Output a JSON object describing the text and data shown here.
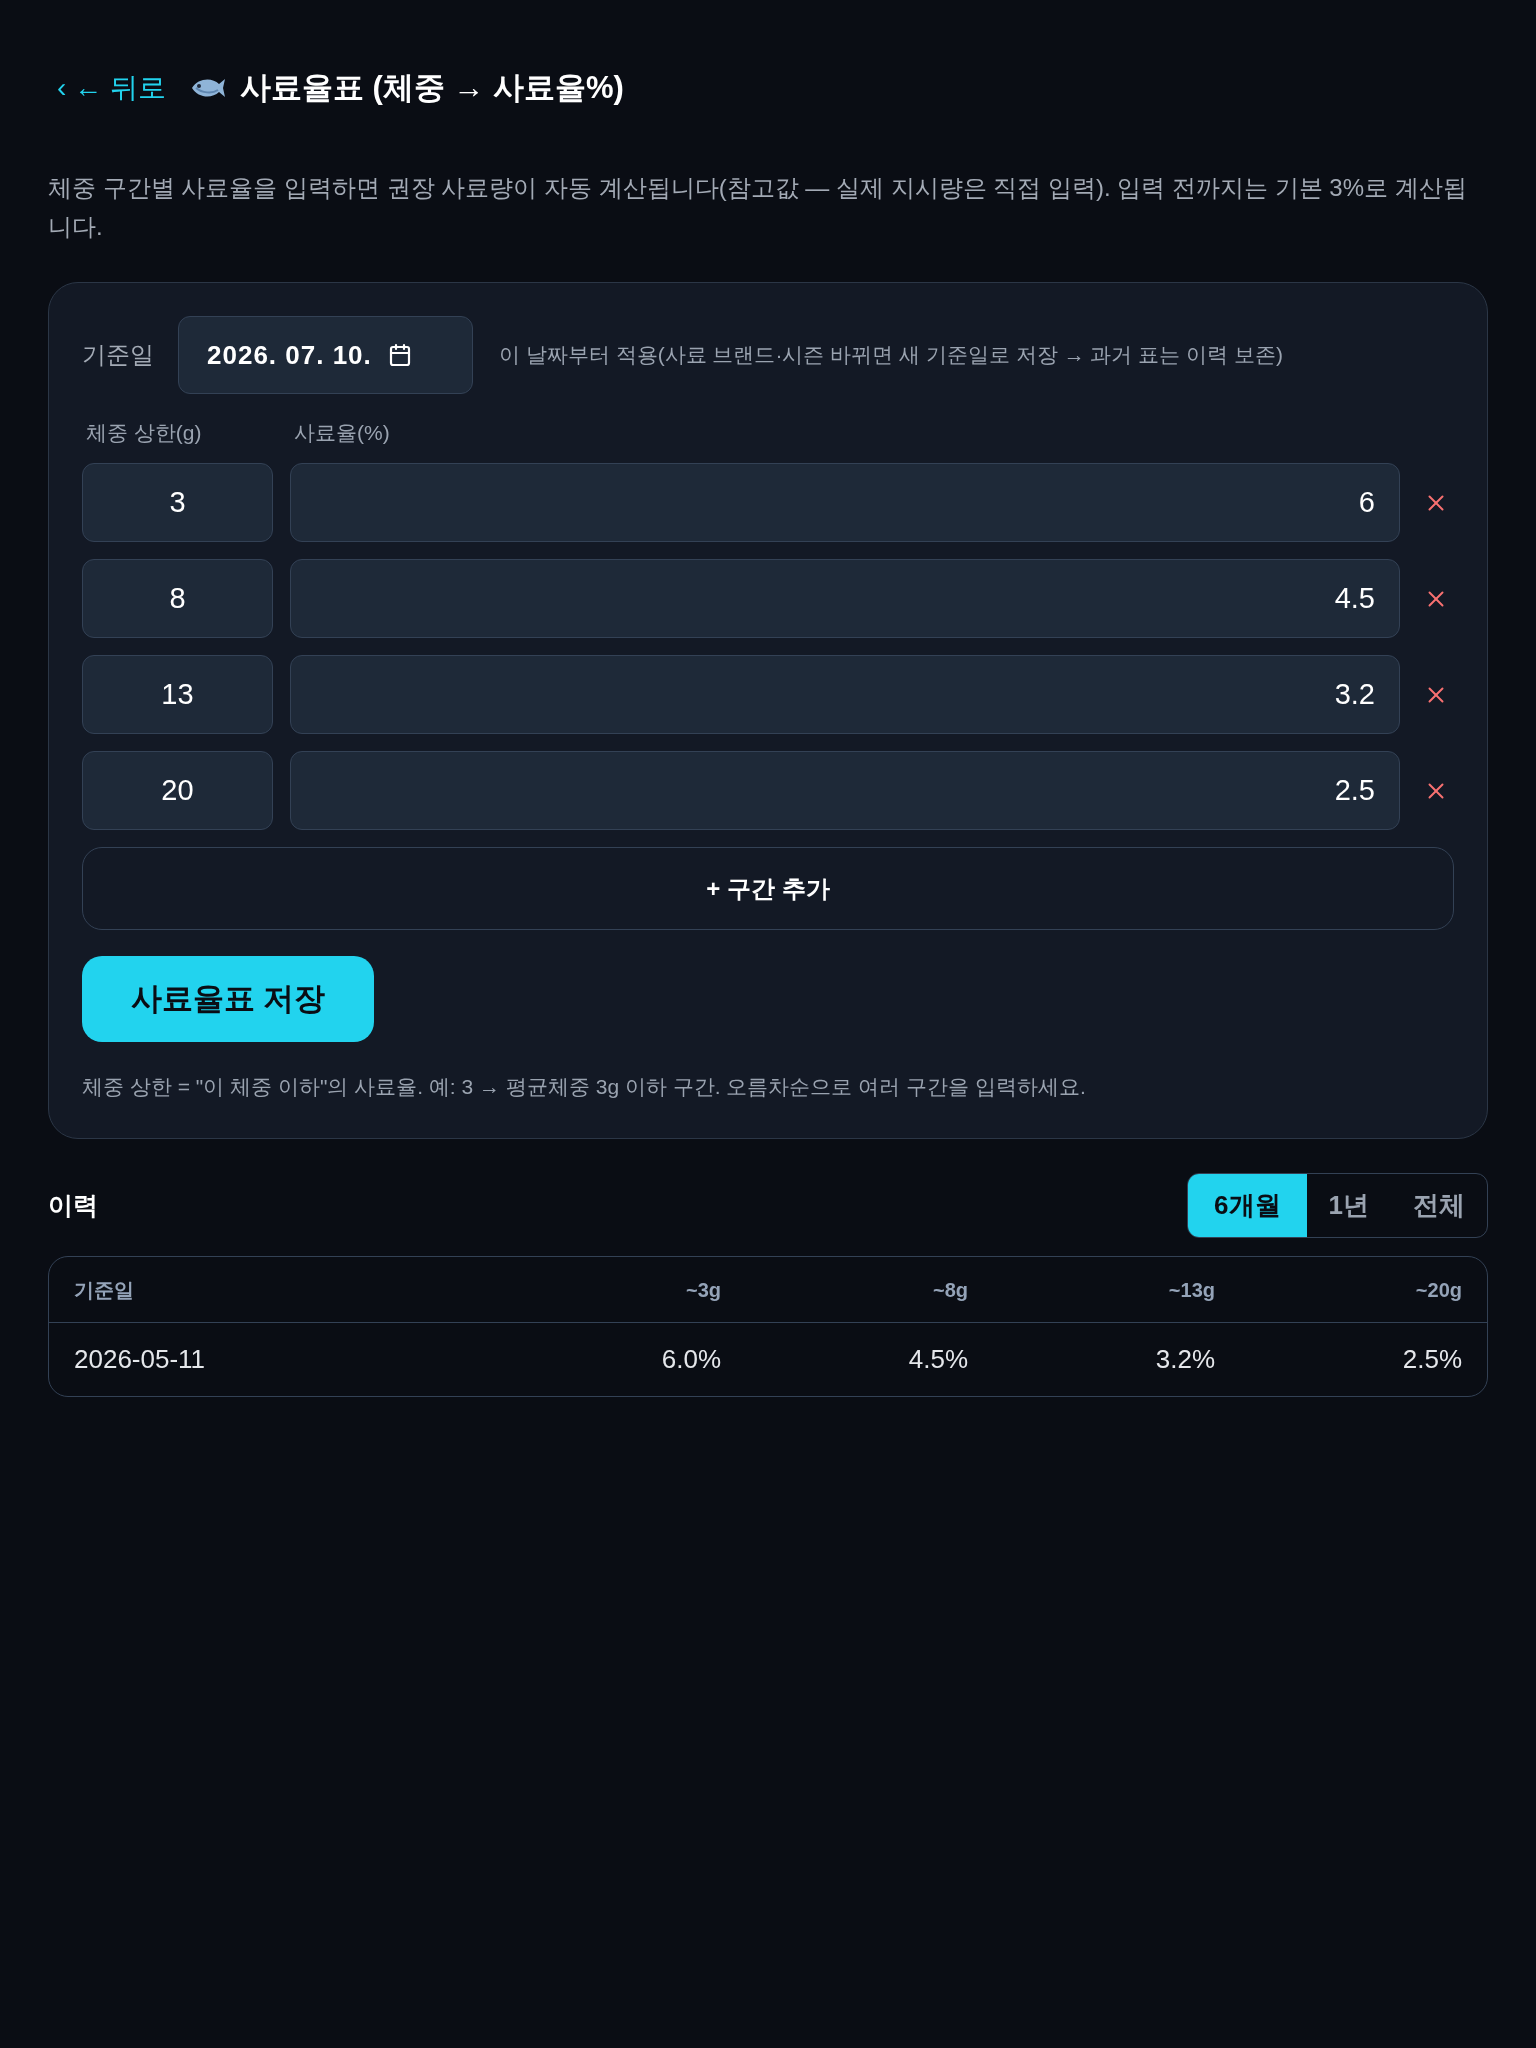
{
  "header": {
    "back_link": "‹ ← 뒤로",
    "title": "사료율표 (체중 → 사료율%)"
  },
  "description": "체중 구간별 사료율을 입력하면 권장 사료량이 자동 계산됩니다(참고값 — 실제 지시량은 직접 입력). 입력 전까지는 기본 3%로 계산됩니다.",
  "rate_form": {
    "date_label": "기준일",
    "date_value": "2026. 07. 10.",
    "date_hint": "이 날짜부터 적용(사료 브랜드·시즌 바뀌면 새 기준일로 저장 → 과거 표는 이력 보존)",
    "columns": [
      "체중 상한(g)",
      "사료율(%)"
    ],
    "rows": [
      {
        "weight_limit": "3",
        "rate": "6"
      },
      {
        "weight_limit": "8",
        "rate": "4.5"
      },
      {
        "weight_limit": "13",
        "rate": "3.2"
      },
      {
        "weight_limit": "20",
        "rate": "2.5"
      }
    ],
    "add_button": "+ 구간 추가",
    "save_button": "사료율표 저장",
    "note": "체중 상한 = \"이 체중 이하\"의 사료율. 예: 3 → 평균체중 3g 이하 구간. 오름차순으로 여러 구간을 입력하세요."
  },
  "history": {
    "title": "이력",
    "ranges": [
      {
        "label": "6개월",
        "selected": true
      },
      {
        "label": "1년",
        "selected": false
      },
      {
        "label": "전체",
        "selected": false
      }
    ],
    "table": {
      "columns": [
        "기준일",
        "~3g",
        "~8g",
        "~13g",
        "~20g"
      ],
      "rows": [
        [
          "2026-05-11",
          "6.0%",
          "4.5%",
          "3.2%",
          "2.5%"
        ]
      ]
    }
  }
}
